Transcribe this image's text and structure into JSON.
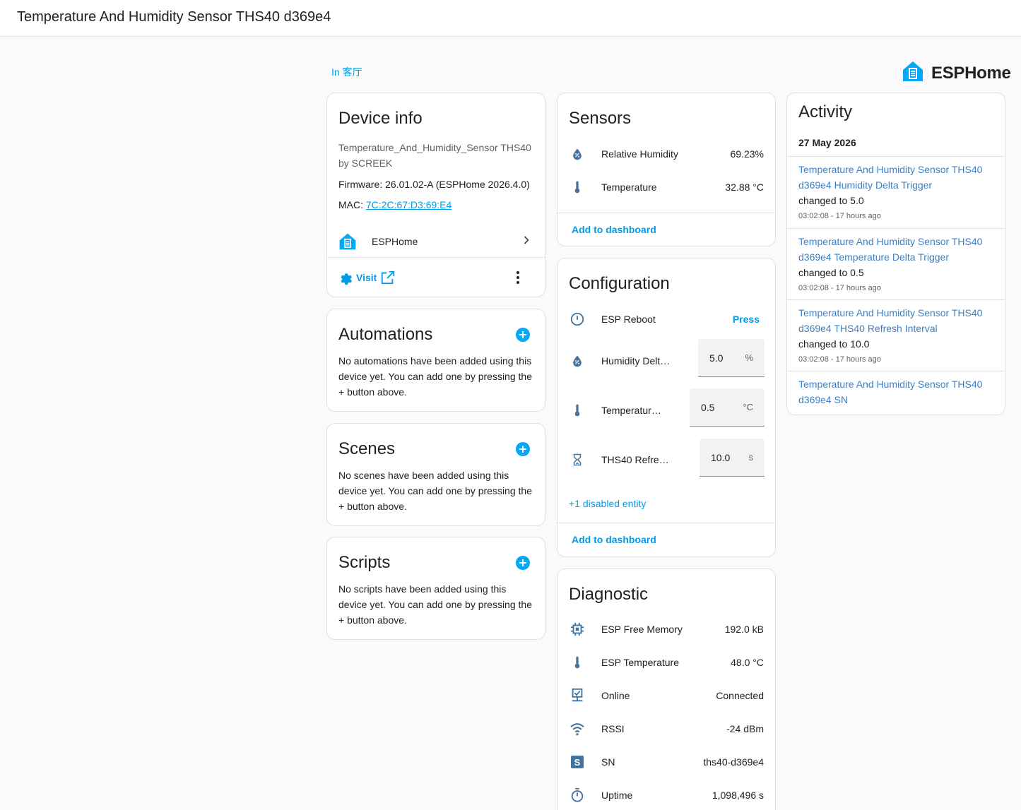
{
  "header": {
    "title": "Temperature And Humidity Sensor THS40 d369e4"
  },
  "area_link": "In 客厅",
  "brand": {
    "name": "ESPHome",
    "color": "#03a9f4"
  },
  "device_info": {
    "title": "Device info",
    "model": "Temperature_And_Humidity_Sensor THS40",
    "manufacturer": "by SCREEK",
    "firmware": "Firmware: 26.01.02-A (ESPHome 2026.4.0)",
    "mac_label": "MAC: ",
    "mac_value": "7C:2C:67:D3:69:E4",
    "integration": "ESPHome",
    "visit_label": "Visit"
  },
  "automations": {
    "title": "Automations",
    "empty_text": "No automations have been added using this device yet. You can add one by pressing the + button above."
  },
  "scenes": {
    "title": "Scenes",
    "empty_text": "No scenes have been added using this device yet. You can add one by pressing the + button above."
  },
  "scripts": {
    "title": "Scripts",
    "empty_text": "No scripts have been added using this device yet. You can add one by pressing the + button above."
  },
  "sensors": {
    "title": "Sensors",
    "items": [
      {
        "label": "Relative Humidity",
        "value": "69.23%",
        "icon": "water-percent-icon"
      },
      {
        "label": "Temperature",
        "value": "32.88 °C",
        "icon": "thermometer-icon"
      }
    ],
    "add_label": "Add to dashboard"
  },
  "configuration": {
    "title": "Configuration",
    "reboot": {
      "label": "ESP Reboot",
      "action": "Press",
      "icon": "restart-icon"
    },
    "numbers": [
      {
        "label": "Humidity Delta Trigger",
        "value": "5.0",
        "unit": "%",
        "icon": "water-percent-icon"
      },
      {
        "label": "Temperature Delta Trigger",
        "value": "0.5",
        "unit": "°C",
        "icon": "thermometer-icon"
      },
      {
        "label": "THS40 Refresh Interval",
        "value": "10.0",
        "unit": "s",
        "icon": "timer-sand-icon"
      }
    ],
    "disabled_label": "+1 disabled entity",
    "add_label": "Add to dashboard"
  },
  "diagnostic": {
    "title": "Diagnostic",
    "items": [
      {
        "label": "ESP Free Memory",
        "value": "192.0 kB",
        "icon": "chip-icon"
      },
      {
        "label": "ESP Temperature",
        "value": "48.0 °C",
        "icon": "thermometer-icon"
      },
      {
        "label": "Online",
        "value": "Connected",
        "icon": "lan-connect-icon"
      },
      {
        "label": "RSSI",
        "value": "-24 dBm",
        "icon": "wifi-icon"
      },
      {
        "label": "SN",
        "value": "ths40-d369e4",
        "icon": "alpha-s-box-icon"
      },
      {
        "label": "Uptime",
        "value": "1,098,496 s",
        "icon": "timer-outline-icon"
      }
    ]
  },
  "activity": {
    "title": "Activity",
    "date": "27 May 2026",
    "entries": [
      {
        "name": "Temperature And Humidity Sensor THS40 d369e4 Humidity Delta Trigger",
        "change": "changed to 5.0",
        "time": "03:02:08 - 17 hours ago"
      },
      {
        "name": "Temperature And Humidity Sensor THS40 d369e4 Temperature Delta Trigger",
        "change": "changed to 0.5",
        "time": "03:02:08 - 17 hours ago"
      },
      {
        "name": "Temperature And Humidity Sensor THS40 d369e4 THS40 Refresh Interval",
        "change": "changed to 10.0",
        "time": "03:02:08 - 17 hours ago"
      },
      {
        "name": "Temperature And Humidity Sensor THS40 d369e4 SN",
        "change": "",
        "time": ""
      }
    ]
  },
  "colors": {
    "accent": "#03a9f4",
    "link": "#039be5",
    "icon": "#44739e",
    "activity_link": "#3f7fbf"
  }
}
